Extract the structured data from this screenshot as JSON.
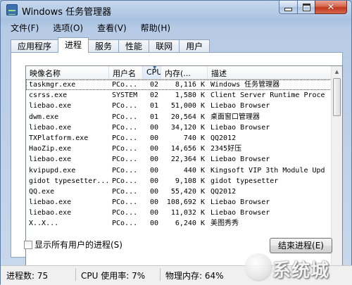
{
  "window": {
    "title": "Windows 任务管理器"
  },
  "menu": [
    "文件(F)",
    "选项(O)",
    "查看(V)",
    "帮助(H)"
  ],
  "tabs": [
    {
      "label": "应用程序",
      "active": false
    },
    {
      "label": "进程",
      "active": true
    },
    {
      "label": "服务",
      "active": false
    },
    {
      "label": "性能",
      "active": false
    },
    {
      "label": "联网",
      "active": false
    },
    {
      "label": "用户",
      "active": false
    }
  ],
  "processes": {
    "columns": [
      "映像名称",
      "用户名",
      "CPU",
      "内存(...",
      "描述"
    ],
    "sorted_column": "CPU",
    "rows": [
      {
        "name": "taskmgr.exe",
        "user": "PCo...",
        "cpu": "02",
        "mem": "8,116 K",
        "desc": "Windows 任务管理器",
        "selected": true
      },
      {
        "name": "csrss.exe",
        "user": "SYSTEM",
        "cpu": "02",
        "mem": "1,580 K",
        "desc": "Client Server Runtime Proce"
      },
      {
        "name": "liebao.exe",
        "user": "PCo...",
        "cpu": "01",
        "mem": "51,000 K",
        "desc": "Liebao Browser"
      },
      {
        "name": "dwm.exe",
        "user": "PCo...",
        "cpu": "01",
        "mem": "20,564 K",
        "desc": "桌面窗口管理器"
      },
      {
        "name": "liebao.exe",
        "user": "PCo...",
        "cpu": "00",
        "mem": "34,120 K",
        "desc": "Liebao Browser"
      },
      {
        "name": "TXPlatform.exe",
        "user": "PCo...",
        "cpu": "00",
        "mem": "740 K",
        "desc": "QQ2012"
      },
      {
        "name": "HaoZip.exe",
        "user": "PCo...",
        "cpu": "00",
        "mem": "14,656 K",
        "desc": "2345好压"
      },
      {
        "name": "liebao.exe",
        "user": "PCo...",
        "cpu": "00",
        "mem": "22,364 K",
        "desc": "Liebao Browser"
      },
      {
        "name": "kvipupd.exe",
        "user": "PCo...",
        "cpu": "00",
        "mem": "440 K",
        "desc": "Kingsoft VIP 3th Module Upd"
      },
      {
        "name": "gidot typesetter...",
        "user": "PCo...",
        "cpu": "00",
        "mem": "9,108 K",
        "desc": "gidot typesetter"
      },
      {
        "name": "QQ.exe",
        "user": "PCo...",
        "cpu": "00",
        "mem": "55,420 K",
        "desc": "QQ2012"
      },
      {
        "name": "liebao.exe",
        "user": "PCo...",
        "cpu": "00",
        "mem": "108,692 K",
        "desc": "Liebao Browser"
      },
      {
        "name": "liebao.exe",
        "user": "PCo...",
        "cpu": "00",
        "mem": "11,032 K",
        "desc": "Liebao Browser"
      },
      {
        "name": "X..X...",
        "user": "PCo...",
        "cpu": "00",
        "mem": "6,240 K",
        "desc": "美图秀秀"
      }
    ]
  },
  "show_all_label": "显示所有用户的进程(S)",
  "end_process_label": "结束进程(E)",
  "status": {
    "process_count": "进程数: 75",
    "cpu_usage": "CPU 使用率: 7%",
    "physical_memory": "物理内存: 64%"
  },
  "watermark_text": "系统城"
}
